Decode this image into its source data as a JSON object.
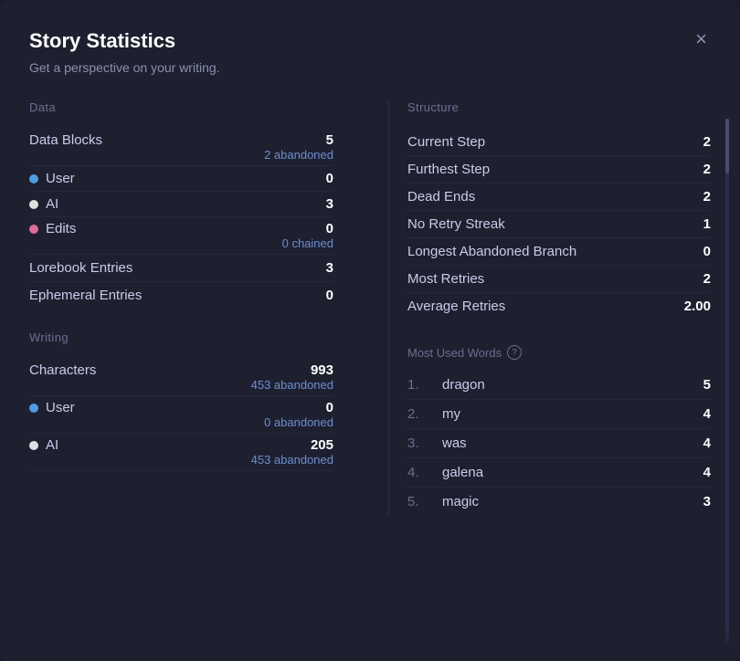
{
  "modal": {
    "title": "Story Statistics",
    "subtitle": "Get a perspective on your writing.",
    "close_label": "×"
  },
  "left": {
    "data_section_label": "Data",
    "data_blocks_label": "Data Blocks",
    "data_blocks_value": "5",
    "data_blocks_sub": "2 abandoned",
    "user_label": "User",
    "user_value": "0",
    "ai_label": "AI",
    "ai_value": "3",
    "edits_label": "Edits",
    "edits_value": "0",
    "edits_sub": "0 chained",
    "lorebook_label": "Lorebook Entries",
    "lorebook_value": "3",
    "ephemeral_label": "Ephemeral Entries",
    "ephemeral_value": "0",
    "writing_section_label": "Writing",
    "characters_label": "Characters",
    "characters_value": "993",
    "characters_sub": "453 abandoned",
    "user2_label": "User",
    "user2_value": "0",
    "user2_sub": "0 abandoned",
    "ai2_label": "AI",
    "ai2_value": "205",
    "ai2_sub": "453 abandoned"
  },
  "right": {
    "structure_label": "Structure",
    "current_step_label": "Current Step",
    "current_step_value": "2",
    "furthest_step_label": "Furthest Step",
    "furthest_step_value": "2",
    "dead_ends_label": "Dead Ends",
    "dead_ends_value": "2",
    "no_retry_label": "No Retry Streak",
    "no_retry_value": "1",
    "longest_branch_label": "Longest Abandoned Branch",
    "longest_branch_value": "0",
    "most_retries_label": "Most Retries",
    "most_retries_value": "2",
    "avg_retries_label": "Average Retries",
    "avg_retries_value": "2.00",
    "words_section_label": "Most Used Words",
    "words": [
      {
        "rank": "1.",
        "word": "dragon",
        "count": "5"
      },
      {
        "rank": "2.",
        "word": "my",
        "count": "4"
      },
      {
        "rank": "3.",
        "word": "was",
        "count": "4"
      },
      {
        "rank": "4.",
        "word": "galena",
        "count": "4"
      },
      {
        "rank": "5.",
        "word": "magic",
        "count": "3"
      }
    ]
  }
}
